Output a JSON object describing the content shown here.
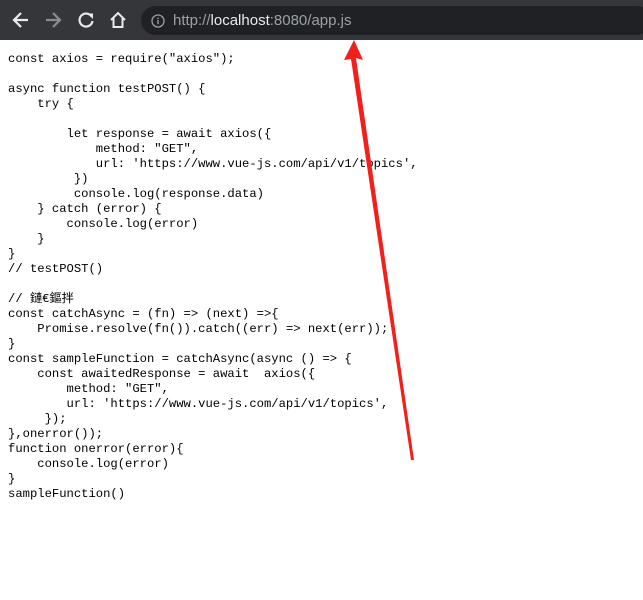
{
  "browser": {
    "url_scheme": "http://",
    "url_host": "localhost",
    "url_rest": ":8080/app.js",
    "icons": [
      "back-arrow-icon",
      "forward-arrow-icon",
      "reload-icon",
      "home-icon",
      "info-icon"
    ]
  },
  "code_lines": [
    "const axios = require(\"axios\");",
    "",
    "async function testPOST() {",
    "    try {",
    "",
    "        let response = await axios({",
    "            method: \"GET\",",
    "            url: 'https://www.vue-js.com/api/v1/topics',",
    "         })",
    "         console.log(response.data)",
    "    } catch (error) {",
    "        console.log(error)",
    "    }",
    "}",
    "// testPOST()",
    "",
    "// 鏈€鏂拌",
    "const catchAsync = (fn) => (next) =>{",
    "    Promise.resolve(fn()).catch((err) => next(err));",
    "}",
    "const sampleFunction = catchAsync(async () => {",
    "    const awaitedResponse = await  axios({",
    "        method: \"GET\",",
    "        url: 'https://www.vue-js.com/api/v1/topics',",
    "     });",
    "},onerror());",
    "function onerror(error){",
    "    console.log(error)",
    "}",
    "sampleFunction()"
  ],
  "annotation": {
    "color": "#f0211c"
  }
}
